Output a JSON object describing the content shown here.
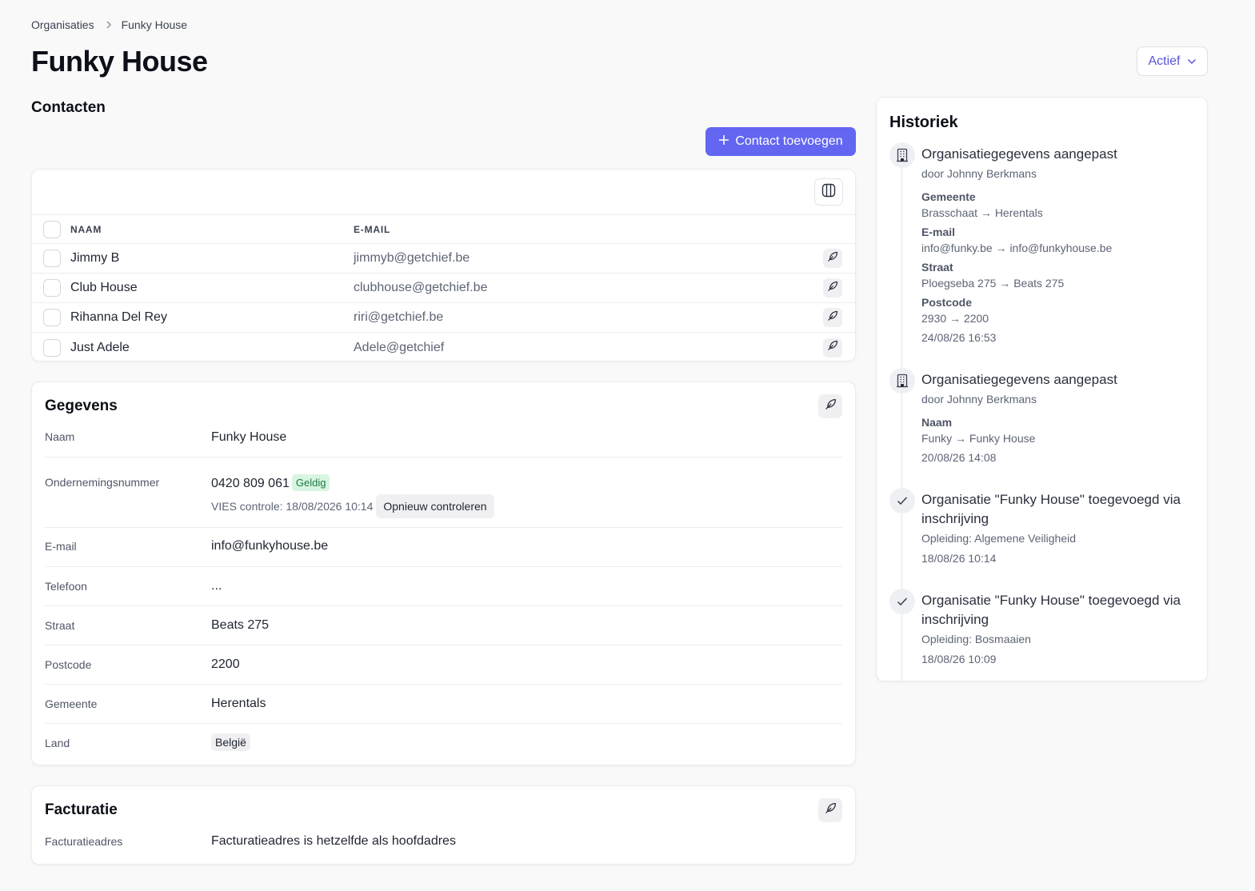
{
  "breadcrumb": {
    "parent": "Organisaties",
    "current": "Funky House"
  },
  "page": {
    "title": "Funky House",
    "status": "Actief"
  },
  "contacts": {
    "title": "Contacten",
    "add_label": "Contact toevoegen",
    "columns": {
      "name": "NAAM",
      "email": "E-MAIL"
    },
    "rows": [
      {
        "name": "Jimmy B",
        "email": "jimmyb@getchief.be"
      },
      {
        "name": "Club House",
        "email": "clubhouse@getchief.be"
      },
      {
        "name": "Rihanna Del Rey",
        "email": "riri@getchief.be"
      },
      {
        "name": "Just Adele",
        "email": "Adele@getchief"
      }
    ]
  },
  "details": {
    "title": "Gegevens",
    "name_label": "Naam",
    "name_value": "Funky House",
    "company_label": "Ondernemingsnummer",
    "company_value": "0420 809 061",
    "company_badge": "Geldig",
    "vies_text": "VIES controle: 18/08/2026 10:14",
    "recheck_label": "Opnieuw controleren",
    "email_label": "E-mail",
    "email_value": "info@funkyhouse.be",
    "phone_label": "Telefoon",
    "phone_value": "...",
    "street_label": "Straat",
    "street_value": "Beats 275",
    "zip_label": "Postcode",
    "zip_value": "2200",
    "city_label": "Gemeente",
    "city_value": "Herentals",
    "country_label": "Land",
    "country_value": "België"
  },
  "billing": {
    "title": "Facturatie",
    "address_label": "Facturatieadres",
    "address_value": "Facturatieadres is hetzelfde als hoofdadres"
  },
  "history": {
    "title": "Historiek",
    "items": [
      {
        "icon": "building-icon",
        "title": "Organisatiegegevens aangepast",
        "by": "door Johnny Berkmans",
        "changes": [
          {
            "label": "Gemeente",
            "value": "Brasschaat → Herentals"
          },
          {
            "label": "E-mail",
            "value": "info@funky.be → info@funkyhouse.be"
          },
          {
            "label": "Straat",
            "value": "Ploegseba 275 → Beats 275"
          },
          {
            "label": "Postcode",
            "value": "2930 → 2200"
          }
        ],
        "date": "24/08/26 16:53"
      },
      {
        "icon": "building-icon",
        "title": "Organisatiegegevens aangepast",
        "by": "door Johnny Berkmans",
        "changes": [
          {
            "label": "Naam",
            "value": "Funky → Funky House"
          }
        ],
        "date": "20/08/26 14:08"
      },
      {
        "icon": "check-icon",
        "title": "Organisatie \"Funky House\" toegevoegd via inschrijving",
        "by": "Opleiding: Algemene Veiligheid",
        "date": "18/08/26 10:14"
      },
      {
        "icon": "check-icon",
        "title": "Organisatie \"Funky House\" toegevoegd via inschrijving",
        "by": "Opleiding: Bosmaaien",
        "date": "18/08/26 10:09"
      }
    ]
  }
}
